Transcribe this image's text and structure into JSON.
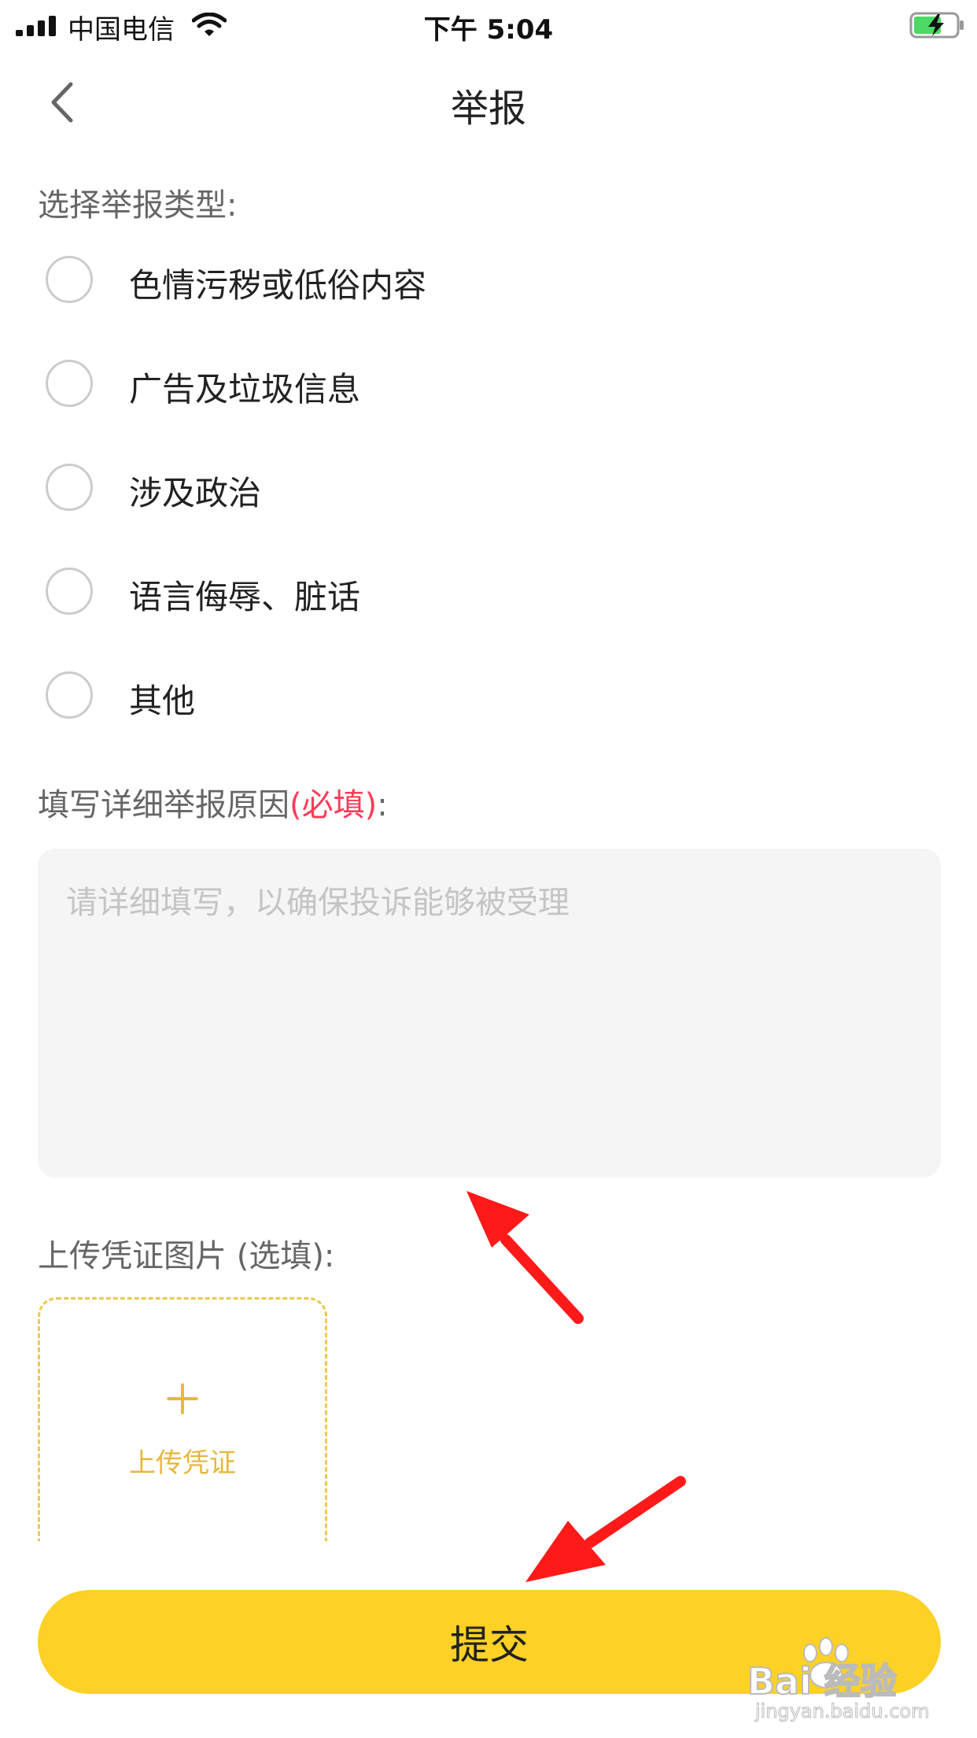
{
  "status_bar": {
    "carrier": "中国电信",
    "time": "下午 5:04",
    "icons": [
      "signal-icon",
      "wifi-icon",
      "battery-charging-icon"
    ],
    "battery_color": "#4cd964"
  },
  "nav": {
    "title": "举报",
    "back_icon": "chevron-left-icon"
  },
  "report_type": {
    "label": "选择举报类型:",
    "options": [
      {
        "label": "色情污秽或低俗内容",
        "selected": false
      },
      {
        "label": "广告及垃圾信息",
        "selected": false
      },
      {
        "label": "涉及政治",
        "selected": false
      },
      {
        "label": "语言侮辱、脏话",
        "selected": false
      },
      {
        "label": "其他",
        "selected": false
      }
    ]
  },
  "reason": {
    "label": "填写详细举报原因",
    "required_tag": "(必填)",
    "colon": ":",
    "placeholder": "请详细填写，以确保投诉能够被受理",
    "value": ""
  },
  "upload": {
    "label": "上传凭证图片 (选填):",
    "button_label": "上传凭证",
    "icon": "plus-icon"
  },
  "submit": {
    "label": "提交"
  },
  "annotations": {
    "icon": "red-arrow-icon",
    "color": "#ff1a1a"
  },
  "watermark": {
    "brand": "Bai 经验",
    "url": "jingyan.baidu.com"
  },
  "colors": {
    "accent": "#fdd125",
    "required": "#ff3b57",
    "upload_accent": "#e8b73c",
    "input_bg": "#f5f5f5"
  }
}
